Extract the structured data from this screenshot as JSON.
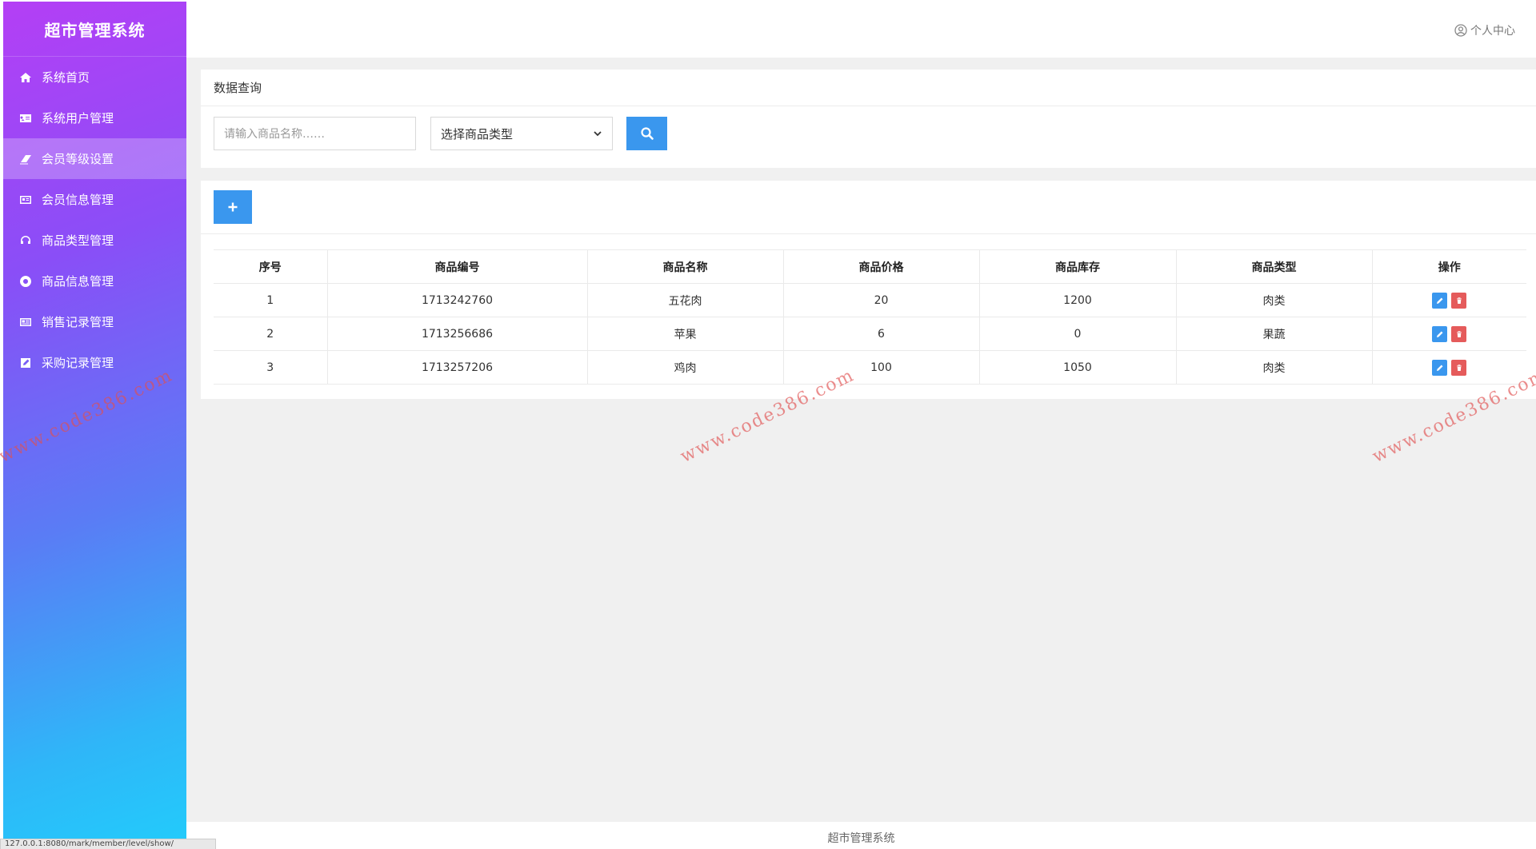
{
  "sidebar": {
    "title": "超市管理系统",
    "items": [
      {
        "label": "系统首页",
        "icon": "home-icon"
      },
      {
        "label": "系统用户管理",
        "icon": "id-card-icon"
      },
      {
        "label": "会员等级设置",
        "icon": "eraser-icon",
        "active": true
      },
      {
        "label": "会员信息管理",
        "icon": "address-card-icon"
      },
      {
        "label": "商品类型管理",
        "icon": "headset-icon"
      },
      {
        "label": "商品信息管理",
        "icon": "lifebuoy-icon"
      },
      {
        "label": "销售记录管理",
        "icon": "newspaper-icon"
      },
      {
        "label": "采购记录管理",
        "icon": "edit-square-icon"
      }
    ]
  },
  "header": {
    "user_center": "个人中心"
  },
  "query": {
    "title": "数据查询",
    "name_placeholder": "请输入商品名称……",
    "type_select": "选择商品类型"
  },
  "table": {
    "columns": [
      "序号",
      "商品编号",
      "商品名称",
      "商品价格",
      "商品库存",
      "商品类型",
      "操作"
    ],
    "rows": [
      [
        "1",
        "1713242760",
        "五花肉",
        "20",
        "1200",
        "肉类"
      ],
      [
        "2",
        "1713256686",
        "苹果",
        "6",
        "0",
        "果蔬"
      ],
      [
        "3",
        "1713257206",
        "鸡肉",
        "100",
        "1050",
        "肉类"
      ]
    ]
  },
  "footer": {
    "text": "超市管理系统"
  },
  "status_url": "127.0.0.1:8080/mark/member/level/show/",
  "watermark": "www.code386.com",
  "colors": {
    "primary": "#3a97ee",
    "danger": "#e55b5b",
    "sidebar_top": "#b43ff5",
    "sidebar_bottom": "#22ccfb"
  }
}
